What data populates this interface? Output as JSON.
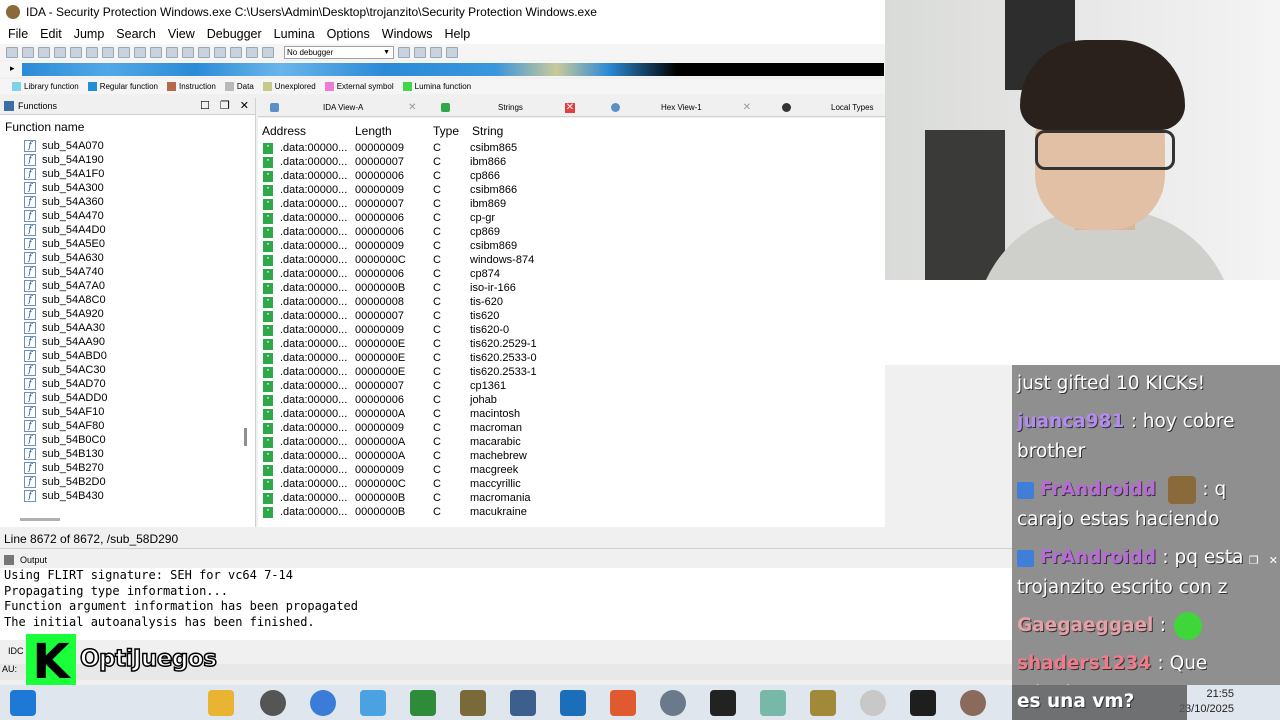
{
  "window": {
    "title": "IDA - Security Protection Windows.exe C:\\Users\\Admin\\Desktop\\trojanzito\\Security Protection Windows.exe"
  },
  "menu": [
    "File",
    "Edit",
    "Jump",
    "Search",
    "View",
    "Debugger",
    "Lumina",
    "Options",
    "Windows",
    "Help"
  ],
  "toolbar": {
    "debugger_select": "No debugger"
  },
  "legend": [
    {
      "label": "Library function",
      "color": "#7fd3e8"
    },
    {
      "label": "Regular function",
      "color": "#1f8fd6"
    },
    {
      "label": "Instruction",
      "color": "#b46a4a"
    },
    {
      "label": "Data",
      "color": "#b9b9b9"
    },
    {
      "label": "Unexplored",
      "color": "#c7c98a"
    },
    {
      "label": "External symbol",
      "color": "#f07ad4"
    },
    {
      "label": "Lumina function",
      "color": "#44d64a"
    }
  ],
  "functions_panel": {
    "title": "Functions",
    "column": "Function name",
    "items": [
      "sub_54A070",
      "sub_54A190",
      "sub_54A1F0",
      "sub_54A300",
      "sub_54A360",
      "sub_54A470",
      "sub_54A4D0",
      "sub_54A5E0",
      "sub_54A630",
      "sub_54A740",
      "sub_54A7A0",
      "sub_54A8C0",
      "sub_54A920",
      "sub_54AA30",
      "sub_54AA90",
      "sub_54ABD0",
      "sub_54AC30",
      "sub_54AD70",
      "sub_54ADD0",
      "sub_54AF10",
      "sub_54AF80",
      "sub_54B0C0",
      "sub_54B130",
      "sub_54B270",
      "sub_54B2D0",
      "sub_54B430"
    ]
  },
  "tabs": [
    {
      "label": "IDA View-A"
    },
    {
      "label": "Strings"
    },
    {
      "label": "Hex View-1"
    },
    {
      "label": "Local Types"
    }
  ],
  "strings_table": {
    "headers": {
      "address": "Address",
      "length": "Length",
      "type": "Type",
      "string": "String"
    },
    "rows": [
      {
        "address": ".data:00000...",
        "length": "00000009",
        "type": "C",
        "string": "csibm865"
      },
      {
        "address": ".data:00000...",
        "length": "00000007",
        "type": "C",
        "string": "ibm866"
      },
      {
        "address": ".data:00000...",
        "length": "00000006",
        "type": "C",
        "string": "cp866"
      },
      {
        "address": ".data:00000...",
        "length": "00000009",
        "type": "C",
        "string": "csibm866"
      },
      {
        "address": ".data:00000...",
        "length": "00000007",
        "type": "C",
        "string": "ibm869"
      },
      {
        "address": ".data:00000...",
        "length": "00000006",
        "type": "C",
        "string": "cp-gr"
      },
      {
        "address": ".data:00000...",
        "length": "00000006",
        "type": "C",
        "string": "cp869"
      },
      {
        "address": ".data:00000...",
        "length": "00000009",
        "type": "C",
        "string": "csibm869"
      },
      {
        "address": ".data:00000...",
        "length": "0000000C",
        "type": "C",
        "string": "windows-874"
      },
      {
        "address": ".data:00000...",
        "length": "00000006",
        "type": "C",
        "string": "cp874"
      },
      {
        "address": ".data:00000...",
        "length": "0000000B",
        "type": "C",
        "string": "iso-ir-166"
      },
      {
        "address": ".data:00000...",
        "length": "00000008",
        "type": "C",
        "string": "tis-620"
      },
      {
        "address": ".data:00000...",
        "length": "00000007",
        "type": "C",
        "string": "tis620"
      },
      {
        "address": ".data:00000...",
        "length": "00000009",
        "type": "C",
        "string": "tis620-0"
      },
      {
        "address": ".data:00000...",
        "length": "0000000E",
        "type": "C",
        "string": "tis620.2529-1"
      },
      {
        "address": ".data:00000...",
        "length": "0000000E",
        "type": "C",
        "string": "tis620.2533-0"
      },
      {
        "address": ".data:00000...",
        "length": "0000000E",
        "type": "C",
        "string": "tis620.2533-1"
      },
      {
        "address": ".data:00000...",
        "length": "00000007",
        "type": "C",
        "string": "cp1361"
      },
      {
        "address": ".data:00000...",
        "length": "00000006",
        "type": "C",
        "string": "johab"
      },
      {
        "address": ".data:00000...",
        "length": "0000000A",
        "type": "C",
        "string": "macintosh"
      },
      {
        "address": ".data:00000...",
        "length": "00000009",
        "type": "C",
        "string": "macroman"
      },
      {
        "address": ".data:00000...",
        "length": "0000000A",
        "type": "C",
        "string": "macarabic"
      },
      {
        "address": ".data:00000...",
        "length": "0000000A",
        "type": "C",
        "string": "machebrew"
      },
      {
        "address": ".data:00000...",
        "length": "00000009",
        "type": "C",
        "string": "macgreek"
      },
      {
        "address": ".data:00000...",
        "length": "0000000C",
        "type": "C",
        "string": "maccyrillic"
      },
      {
        "address": ".data:00000...",
        "length": "0000000B",
        "type": "C",
        "string": "macromania"
      },
      {
        "address": ".data:00000...",
        "length": "0000000B",
        "type": "C",
        "string": "macukraine"
      }
    ]
  },
  "status_line": "Line 8672 of 8672, /sub_58D290",
  "output": {
    "title": "Output",
    "lines": [
      "Using FLIRT signature: SEH for vc64 7-14",
      "Propagating type information...",
      "Function argument information has been propagated",
      "The initial autoanalysis has been finished."
    ],
    "idc_label": "IDC",
    "status_prefix": "AU:"
  },
  "overlay": {
    "logo_letter": "K",
    "channel_name": "OptiJuegos"
  },
  "chat": {
    "messages": [
      {
        "user": "",
        "text": "just gifted 10 KICKs!",
        "user_color": ""
      },
      {
        "user": "juanca981",
        "text": ": hoy cobre brother",
        "user_color": "#b48cf0"
      },
      {
        "user": "FrAndroidd",
        "text": ": q carajo estas haciendo",
        "user_color": "#b86ad9"
      },
      {
        "user": "FrAndroidd",
        "text": ": pq esta trojanzito escrito con z",
        "user_color": "#b86ad9"
      },
      {
        "user": "Gaegaeggael",
        "text": ":",
        "user_color": "#e8a0a8"
      },
      {
        "user": "shaders1234",
        "text": ": Que mierda es una vm?",
        "user_color": "#f07a8a"
      }
    ]
  },
  "taskbar": {
    "time": "21:55",
    "date": "23/10/2025"
  }
}
